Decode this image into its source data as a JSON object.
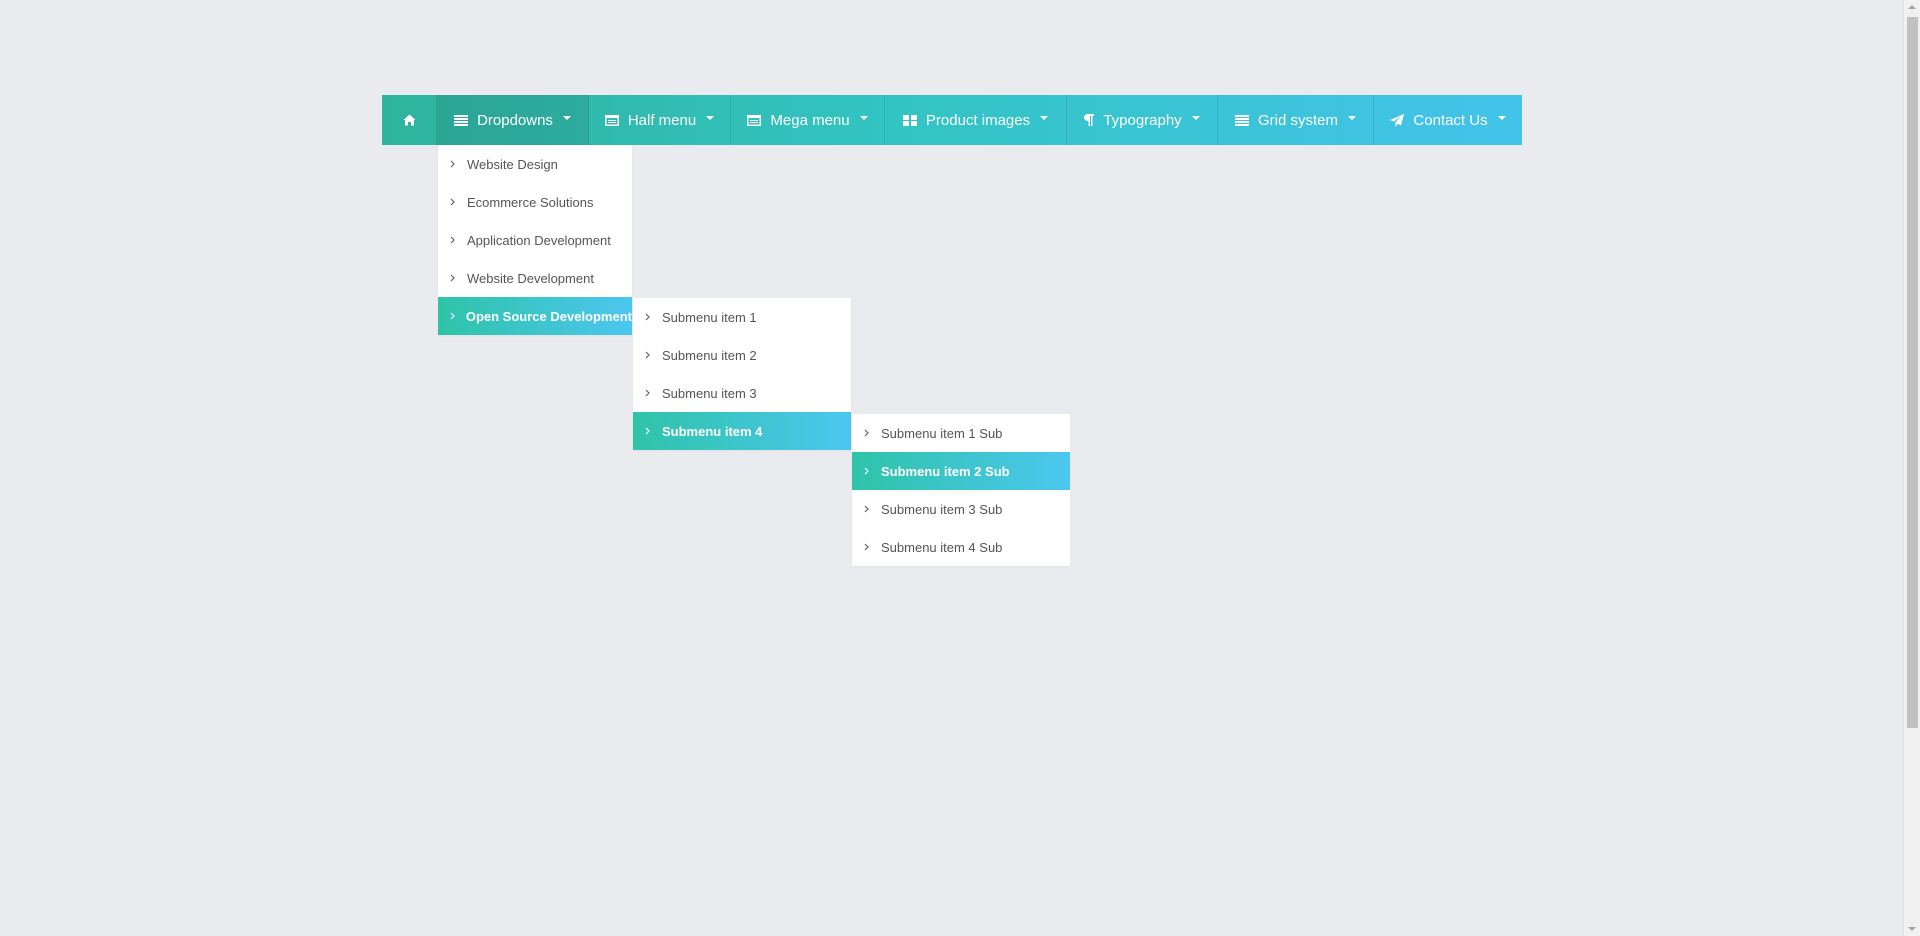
{
  "colors": {
    "page_bg": "#e9ebee",
    "nav_gradient_start": "#2fb39e",
    "nav_gradient_end": "#43c3eb",
    "highlight_start": "#2ec4a8",
    "highlight_end": "#4cc6f0",
    "menu_text": "#555555"
  },
  "nav": {
    "items": [
      {
        "label": "",
        "icon": "home-icon"
      },
      {
        "label": "Dropdowns",
        "icon": "list-icon"
      },
      {
        "label": "Half menu",
        "icon": "window-icon"
      },
      {
        "label": "Mega menu",
        "icon": "window-icon"
      },
      {
        "label": "Product images",
        "icon": "grid-icon"
      },
      {
        "label": "Typography",
        "icon": "paragraph-icon"
      },
      {
        "label": "Grid system",
        "icon": "list-icon"
      },
      {
        "label": "Contact Us",
        "icon": "paper-plane-icon"
      }
    ]
  },
  "dropdown": {
    "items": [
      {
        "label": "Website Design"
      },
      {
        "label": "Ecommerce Solutions"
      },
      {
        "label": "Application Development"
      },
      {
        "label": "Website Development"
      },
      {
        "label": "Open Source Development"
      }
    ]
  },
  "submenu": {
    "items": [
      {
        "label": "Submenu item 1"
      },
      {
        "label": "Submenu item 2"
      },
      {
        "label": "Submenu item 3"
      },
      {
        "label": "Submenu item 4"
      }
    ]
  },
  "subsubmenu": {
    "items": [
      {
        "label": "Submenu item 1 Sub"
      },
      {
        "label": "Submenu item 2 Sub"
      },
      {
        "label": "Submenu item 3 Sub"
      },
      {
        "label": "Submenu item 4 Sub"
      }
    ]
  }
}
